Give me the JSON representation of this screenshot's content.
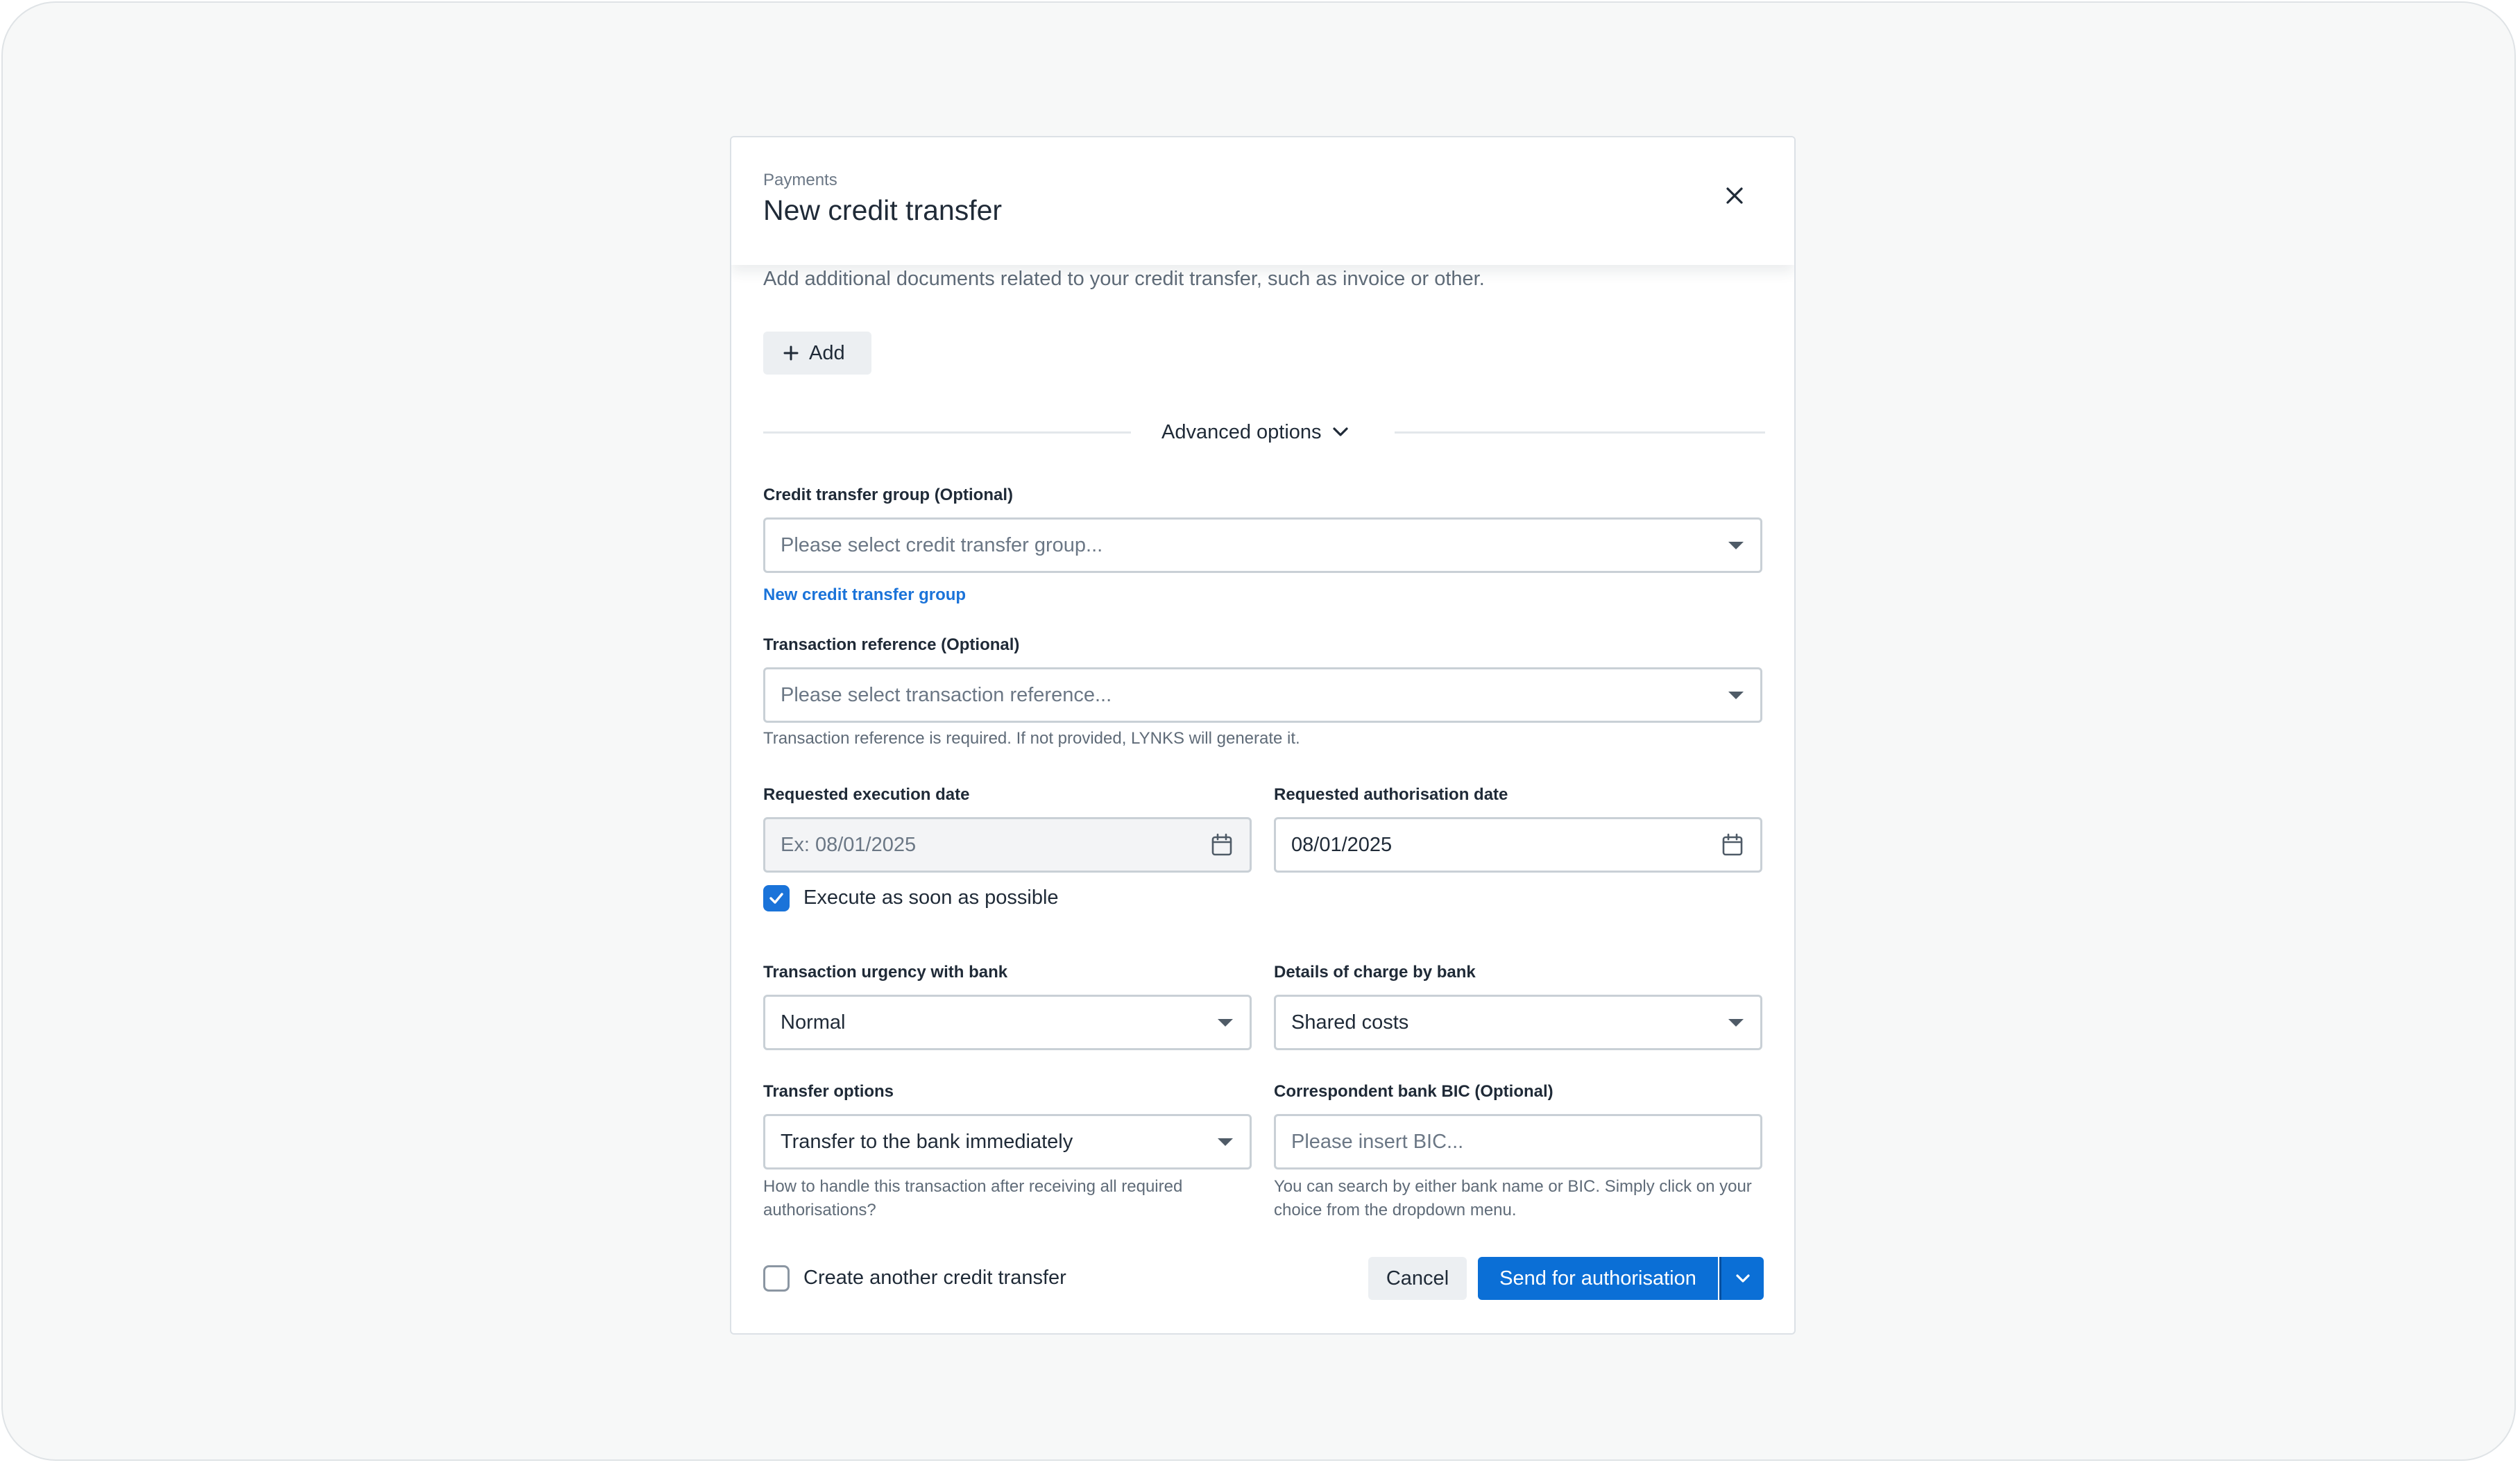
{
  "header": {
    "eyebrow": "Payments",
    "title": "New credit transfer"
  },
  "attachments": {
    "description": "Add additional documents related to your credit transfer, such as invoice or other.",
    "add_label": "Add"
  },
  "advanced": {
    "label": "Advanced options"
  },
  "group": {
    "label": "Credit transfer group (Optional)",
    "placeholder": "Please select credit transfer group...",
    "new_link": "New credit transfer group"
  },
  "reference": {
    "label": "Transaction reference (Optional)",
    "placeholder": "Please select transaction reference...",
    "help": "Transaction reference is required. If not provided, LYNKS will generate it."
  },
  "execution_date": {
    "label": "Requested execution date",
    "placeholder": "Ex: 08/01/2025"
  },
  "authorisation_date": {
    "label": "Requested authorisation date",
    "value": "08/01/2025"
  },
  "asap": {
    "label": "Execute as soon as possible",
    "checked": true
  },
  "urgency": {
    "label": "Transaction urgency with bank",
    "value": "Normal"
  },
  "charges": {
    "label": "Details of charge by bank",
    "value": "Shared costs"
  },
  "transfer_options": {
    "label": "Transfer options",
    "value": "Transfer to the bank immediately",
    "help": "How to handle this transaction after receiving all required authorisations?"
  },
  "bic": {
    "label": "Correspondent bank BIC (Optional)",
    "placeholder": "Please insert BIC...",
    "help": "You can search by either bank name or BIC. Simply click on your choice from the dropdown menu."
  },
  "footer": {
    "another_label": "Create another credit transfer",
    "another_checked": false,
    "cancel_label": "Cancel",
    "send_label": "Send for authorisation"
  },
  "colors": {
    "primary": "#0b6fd6",
    "link": "#1a73d9",
    "text": "#1f2a37",
    "muted": "#5f6b78"
  },
  "icons": [
    "close-icon",
    "plus-icon",
    "chevron-down-icon",
    "calendar-icon",
    "checkmark-icon",
    "caret-down-icon"
  ]
}
